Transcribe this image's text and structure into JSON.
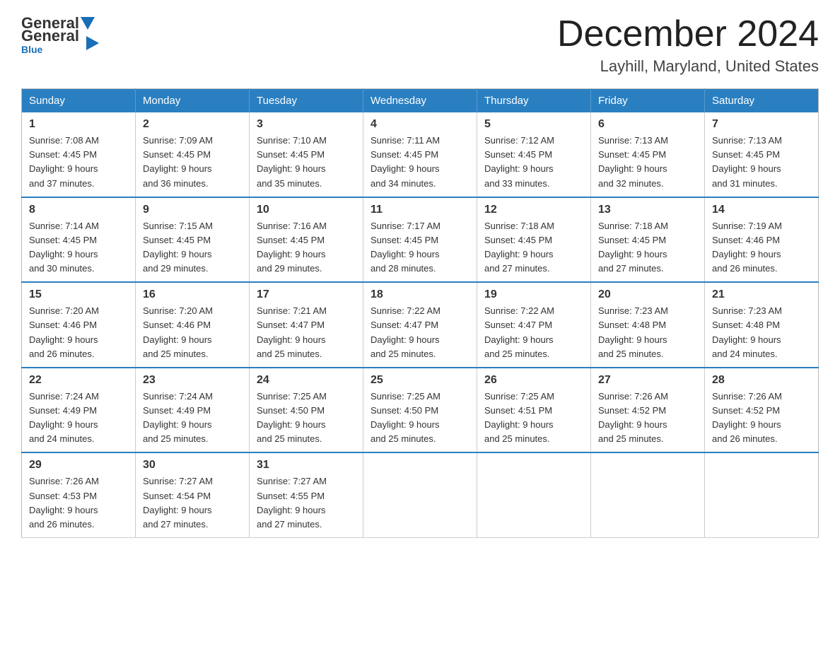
{
  "header": {
    "logo": {
      "general": "General",
      "blue": "Blue"
    },
    "title": "December 2024",
    "subtitle": "Layhill, Maryland, United States"
  },
  "weekdays": [
    "Sunday",
    "Monday",
    "Tuesday",
    "Wednesday",
    "Thursday",
    "Friday",
    "Saturday"
  ],
  "weeks": [
    [
      {
        "day": "1",
        "sunrise": "7:08 AM",
        "sunset": "4:45 PM",
        "daylight": "9 hours and 37 minutes."
      },
      {
        "day": "2",
        "sunrise": "7:09 AM",
        "sunset": "4:45 PM",
        "daylight": "9 hours and 36 minutes."
      },
      {
        "day": "3",
        "sunrise": "7:10 AM",
        "sunset": "4:45 PM",
        "daylight": "9 hours and 35 minutes."
      },
      {
        "day": "4",
        "sunrise": "7:11 AM",
        "sunset": "4:45 PM",
        "daylight": "9 hours and 34 minutes."
      },
      {
        "day": "5",
        "sunrise": "7:12 AM",
        "sunset": "4:45 PM",
        "daylight": "9 hours and 33 minutes."
      },
      {
        "day": "6",
        "sunrise": "7:13 AM",
        "sunset": "4:45 PM",
        "daylight": "9 hours and 32 minutes."
      },
      {
        "day": "7",
        "sunrise": "7:13 AM",
        "sunset": "4:45 PM",
        "daylight": "9 hours and 31 minutes."
      }
    ],
    [
      {
        "day": "8",
        "sunrise": "7:14 AM",
        "sunset": "4:45 PM",
        "daylight": "9 hours and 30 minutes."
      },
      {
        "day": "9",
        "sunrise": "7:15 AM",
        "sunset": "4:45 PM",
        "daylight": "9 hours and 29 minutes."
      },
      {
        "day": "10",
        "sunrise": "7:16 AM",
        "sunset": "4:45 PM",
        "daylight": "9 hours and 29 minutes."
      },
      {
        "day": "11",
        "sunrise": "7:17 AM",
        "sunset": "4:45 PM",
        "daylight": "9 hours and 28 minutes."
      },
      {
        "day": "12",
        "sunrise": "7:18 AM",
        "sunset": "4:45 PM",
        "daylight": "9 hours and 27 minutes."
      },
      {
        "day": "13",
        "sunrise": "7:18 AM",
        "sunset": "4:45 PM",
        "daylight": "9 hours and 27 minutes."
      },
      {
        "day": "14",
        "sunrise": "7:19 AM",
        "sunset": "4:46 PM",
        "daylight": "9 hours and 26 minutes."
      }
    ],
    [
      {
        "day": "15",
        "sunrise": "7:20 AM",
        "sunset": "4:46 PM",
        "daylight": "9 hours and 26 minutes."
      },
      {
        "day": "16",
        "sunrise": "7:20 AM",
        "sunset": "4:46 PM",
        "daylight": "9 hours and 25 minutes."
      },
      {
        "day": "17",
        "sunrise": "7:21 AM",
        "sunset": "4:47 PM",
        "daylight": "9 hours and 25 minutes."
      },
      {
        "day": "18",
        "sunrise": "7:22 AM",
        "sunset": "4:47 PM",
        "daylight": "9 hours and 25 minutes."
      },
      {
        "day": "19",
        "sunrise": "7:22 AM",
        "sunset": "4:47 PM",
        "daylight": "9 hours and 25 minutes."
      },
      {
        "day": "20",
        "sunrise": "7:23 AM",
        "sunset": "4:48 PM",
        "daylight": "9 hours and 25 minutes."
      },
      {
        "day": "21",
        "sunrise": "7:23 AM",
        "sunset": "4:48 PM",
        "daylight": "9 hours and 24 minutes."
      }
    ],
    [
      {
        "day": "22",
        "sunrise": "7:24 AM",
        "sunset": "4:49 PM",
        "daylight": "9 hours and 24 minutes."
      },
      {
        "day": "23",
        "sunrise": "7:24 AM",
        "sunset": "4:49 PM",
        "daylight": "9 hours and 25 minutes."
      },
      {
        "day": "24",
        "sunrise": "7:25 AM",
        "sunset": "4:50 PM",
        "daylight": "9 hours and 25 minutes."
      },
      {
        "day": "25",
        "sunrise": "7:25 AM",
        "sunset": "4:50 PM",
        "daylight": "9 hours and 25 minutes."
      },
      {
        "day": "26",
        "sunrise": "7:25 AM",
        "sunset": "4:51 PM",
        "daylight": "9 hours and 25 minutes."
      },
      {
        "day": "27",
        "sunrise": "7:26 AM",
        "sunset": "4:52 PM",
        "daylight": "9 hours and 25 minutes."
      },
      {
        "day": "28",
        "sunrise": "7:26 AM",
        "sunset": "4:52 PM",
        "daylight": "9 hours and 26 minutes."
      }
    ],
    [
      {
        "day": "29",
        "sunrise": "7:26 AM",
        "sunset": "4:53 PM",
        "daylight": "9 hours and 26 minutes."
      },
      {
        "day": "30",
        "sunrise": "7:27 AM",
        "sunset": "4:54 PM",
        "daylight": "9 hours and 27 minutes."
      },
      {
        "day": "31",
        "sunrise": "7:27 AM",
        "sunset": "4:55 PM",
        "daylight": "9 hours and 27 minutes."
      },
      null,
      null,
      null,
      null
    ]
  ],
  "labels": {
    "sunrise": "Sunrise:",
    "sunset": "Sunset:",
    "daylight": "Daylight:"
  }
}
